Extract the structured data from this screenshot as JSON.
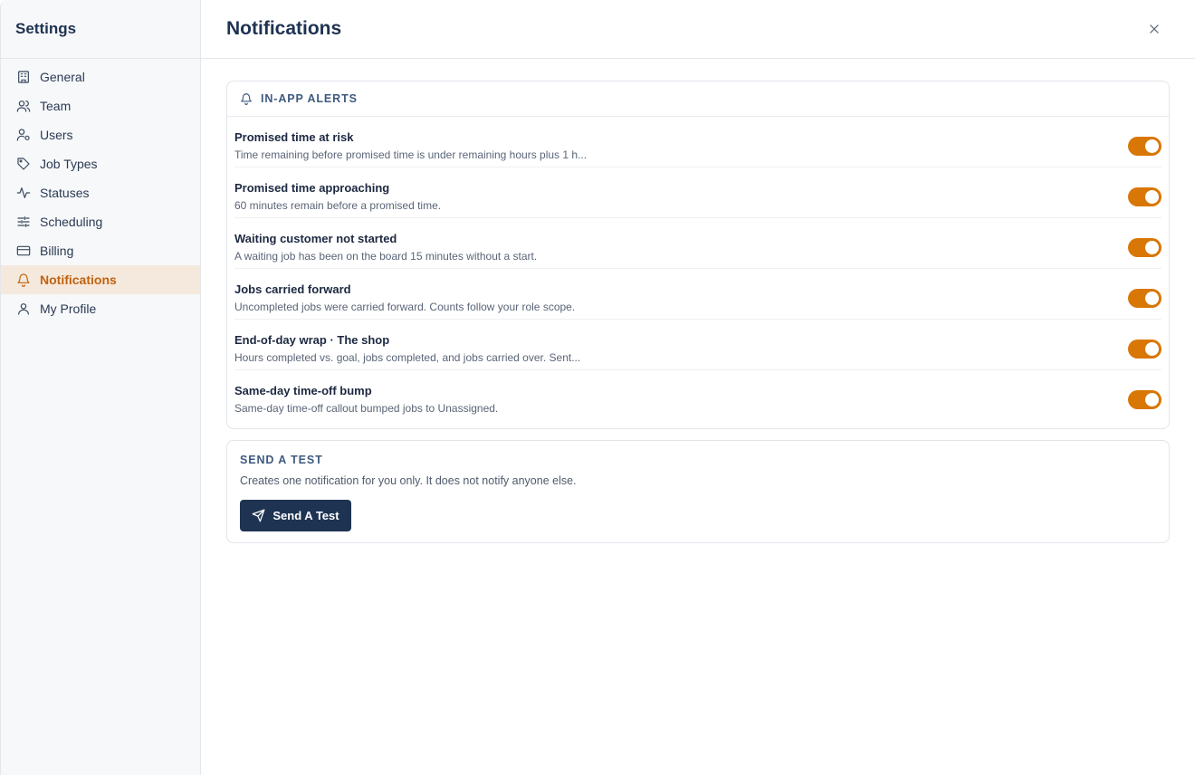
{
  "sidebar": {
    "title": "Settings",
    "items": [
      {
        "label": "General",
        "icon": "building-icon"
      },
      {
        "label": "Team",
        "icon": "users-icon"
      },
      {
        "label": "Users",
        "icon": "user-settings-icon"
      },
      {
        "label": "Job Types",
        "icon": "tag-icon"
      },
      {
        "label": "Statuses",
        "icon": "activity-icon"
      },
      {
        "label": "Scheduling",
        "icon": "sliders-icon"
      },
      {
        "label": "Billing",
        "icon": "credit-card-icon"
      },
      {
        "label": "Notifications",
        "icon": "bell-icon",
        "active": true
      },
      {
        "label": "My Profile",
        "icon": "user-icon"
      }
    ]
  },
  "header": {
    "title": "Notifications",
    "close_icon": "close-icon"
  },
  "alerts": {
    "section_title": "IN-APP ALERTS",
    "icon": "bell-icon",
    "items": [
      {
        "title": "Promised time at risk",
        "description": "Time remaining before promised time is under remaining hours plus 1 h...",
        "enabled": true
      },
      {
        "title": "Promised time approaching",
        "description": "60 minutes remain before a promised time.",
        "enabled": true
      },
      {
        "title": "Waiting customer not started",
        "description": "A waiting job has been on the board 15 minutes without a start.",
        "enabled": true
      },
      {
        "title": "Jobs carried forward",
        "description": "Uncompleted jobs were carried forward. Counts follow your role scope.",
        "enabled": true
      },
      {
        "title": "End-of-day wrap · The shop",
        "description": "Hours completed vs. goal, jobs completed, and jobs carried over. Sent...",
        "enabled": true
      },
      {
        "title": "Same-day time-off bump",
        "description": "Same-day time-off callout bumped jobs to Unassigned.",
        "enabled": true
      }
    ]
  },
  "test": {
    "section_title": "SEND A TEST",
    "description": "Creates one notification for you only. It does not notify anyone else.",
    "button_label": "Send A Test",
    "button_icon": "send-icon"
  },
  "colors": {
    "accent": "#d97706",
    "active_nav_bg": "#f5e9dd",
    "active_nav_text": "#c2620e",
    "primary_button": "#1e3352"
  }
}
